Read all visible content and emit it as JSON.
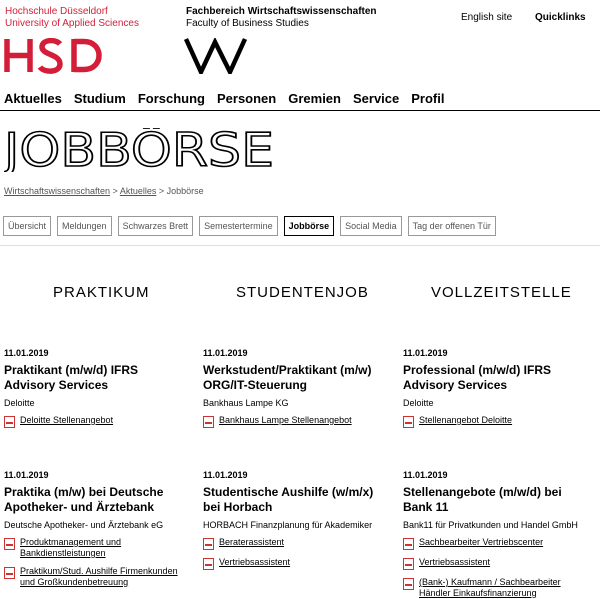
{
  "header": {
    "hsd_line1": "Hochschule Düsseldorf",
    "hsd_line2": "University of Applied Sciences",
    "hsd_logo": "HSD",
    "fb_line1": "Fachbereich Wirtschaftswissenschaften",
    "fb_line2": "Faculty of Business Studies",
    "english_link": "English site",
    "quicklinks": "Quicklinks",
    "brand_color": "#d41e39"
  },
  "mainnav": [
    "Aktuelles",
    "Studium",
    "Forschung",
    "Personen",
    "Gremien",
    "Service",
    "Profil"
  ],
  "page_title": "JOBBÖRSE",
  "breadcrumb": {
    "part1": "Wirtschaftswissenschaften",
    "sep": " > ",
    "part2": "Aktuelles",
    "current": "Jobbörse"
  },
  "subnav": [
    {
      "label": "Übersicht",
      "active": false
    },
    {
      "label": "Meldungen",
      "active": false
    },
    {
      "label": "Schwarzes Brett",
      "active": false
    },
    {
      "label": "Semestertermine",
      "active": false
    },
    {
      "label": "Jobbörse",
      "active": true
    },
    {
      "label": "Social Media",
      "active": false
    },
    {
      "label": "Tag der offenen Tür",
      "active": false
    }
  ],
  "columns": [
    {
      "heading": "PRAKTIKUM",
      "jobs": [
        {
          "date": "11.01.2019",
          "title": "Praktikant (m/w/d) IFRS Advisory Services",
          "company": "Deloitte",
          "links": [
            "Deloitte Stellenangebot"
          ]
        },
        {
          "date": "11.01.2019",
          "title": "Praktika (m/w) bei Deutsche Apotheker- und Ärztebank",
          "company": "Deutsche Apotheker- und Ärztebank eG",
          "links": [
            "Produktmanagement und Bankdienstleistungen",
            "Praktikum/Stud. Aushilfe Firmenkunden und Großkundenbetreuung"
          ]
        }
      ]
    },
    {
      "heading": "STUDENTENJOB",
      "jobs": [
        {
          "date": "11.01.2019",
          "title": "Werkstudent/Praktikant (m/w) ORG/IT-Steuerung",
          "company": "Bankhaus Lampe KG",
          "links": [
            "Bankhaus Lampe Stellenangebot"
          ]
        },
        {
          "date": "11.01.2019",
          "title": "Studentische Aushilfe (w/m/x) bei Horbach",
          "company": "HORBACH Finanzplanung für Akademiker",
          "links": [
            "Beraterassistent",
            "Vertriebsassistent"
          ]
        }
      ]
    },
    {
      "heading": "VOLLZEITSTELLE",
      "jobs": [
        {
          "date": "11.01.2019",
          "title": "Professional (m/w/d) IFRS Advisory Services",
          "company": "Deloitte",
          "links": [
            "Stellenangebot Deloitte"
          ]
        },
        {
          "date": "11.01.2019",
          "title": "Stellenangebote (m/w/d) bei Bank 11",
          "company": "Bank11 für Privatkunden und Handel GmbH",
          "links": [
            "Sachbearbeiter Vertriebscenter",
            "Vertriebsassistent",
            "(Bank-) Kaufmann / Sachbearbeiter Händler Einkaufsfinanzierung"
          ]
        }
      ]
    }
  ]
}
